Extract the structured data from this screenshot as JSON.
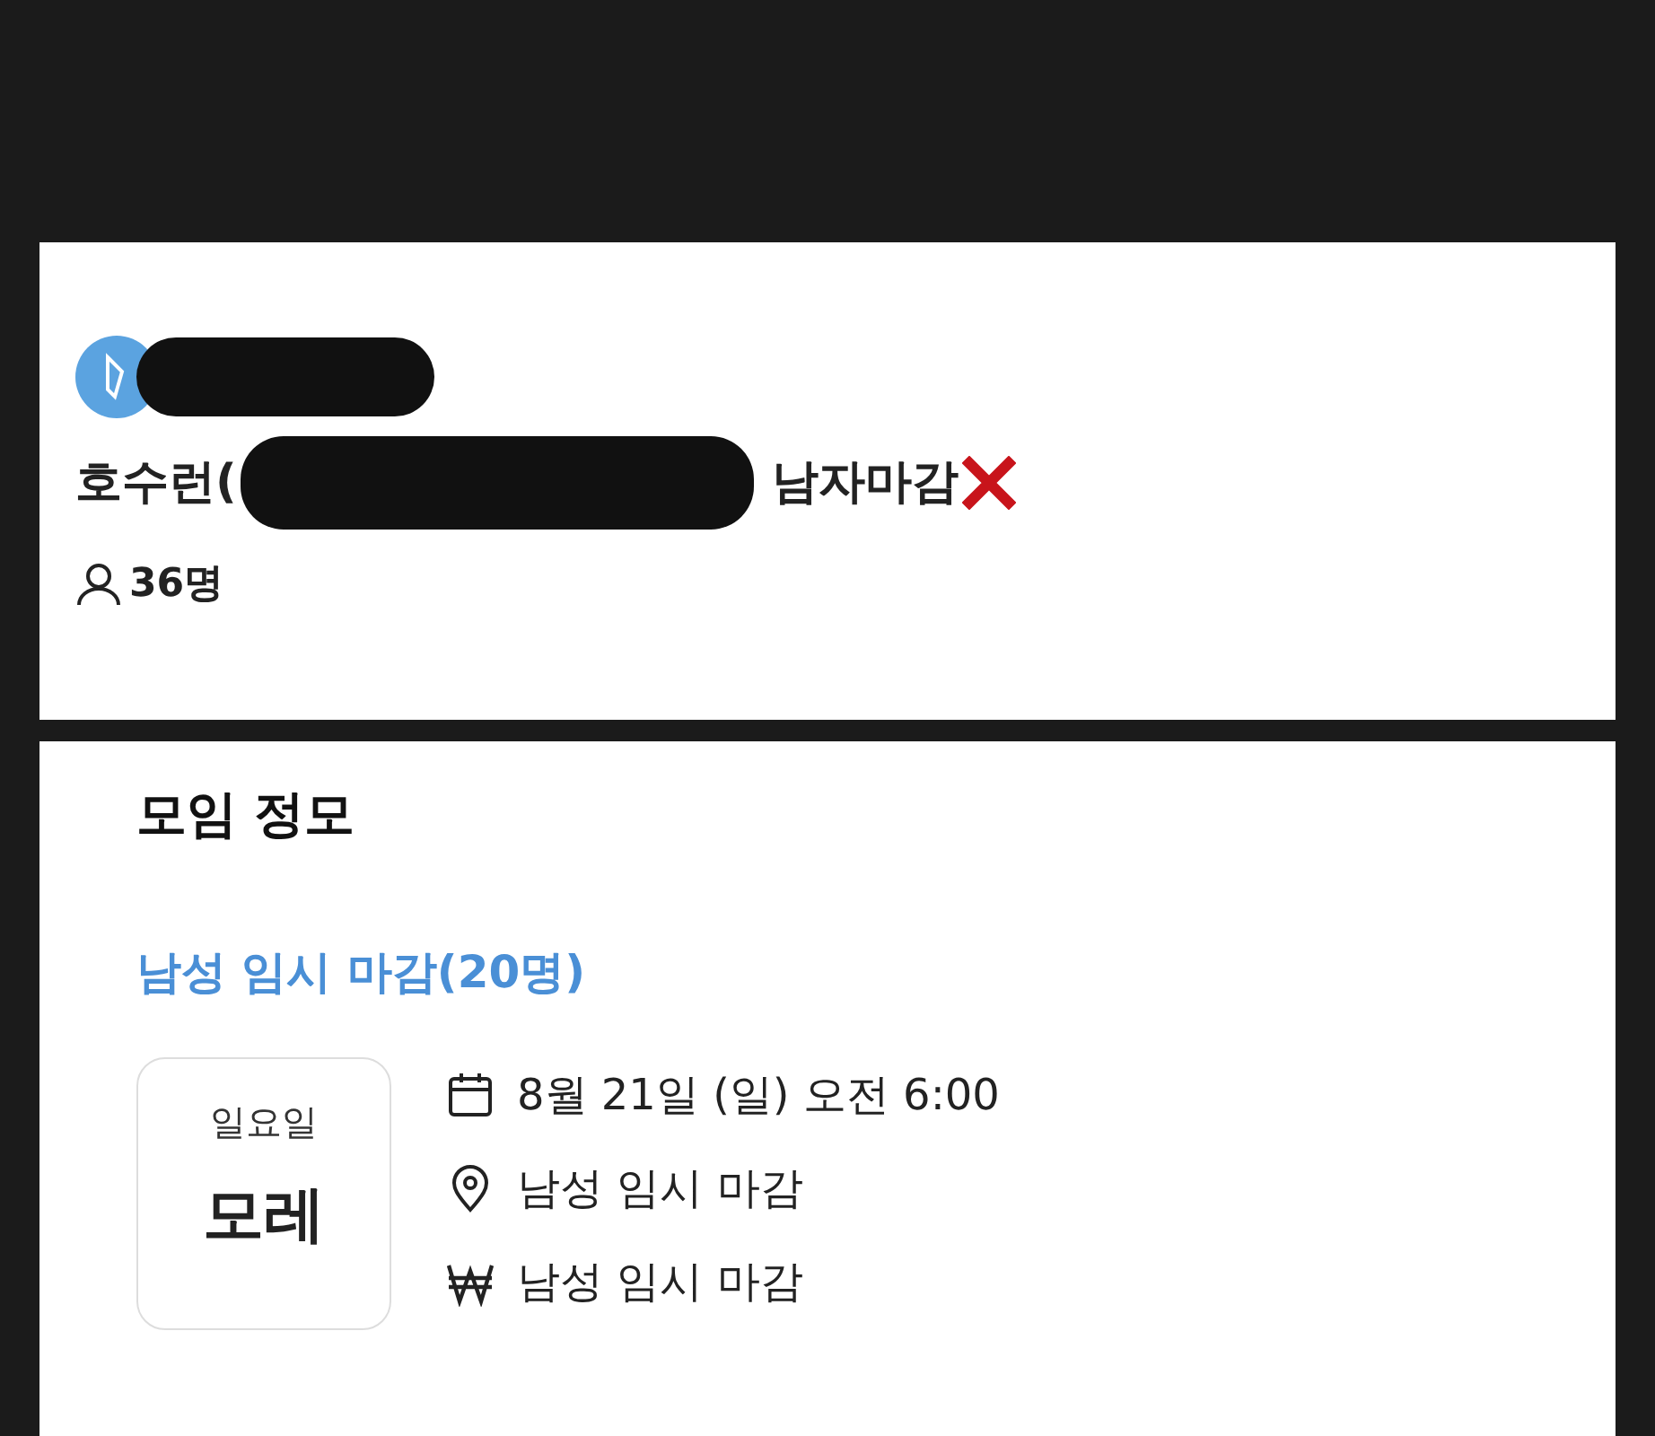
{
  "group": {
    "title_start": "호수런(",
    "title_end": "남자마감",
    "members": "36명"
  },
  "section": {
    "title": "모임 정모",
    "meetup": {
      "name": "남성 임시 마감(20명)",
      "weekday": "일요일",
      "day_label": "모레",
      "details": [
        {
          "kind": "date",
          "text": "8월 21일 (일) 오전 6:00"
        },
        {
          "kind": "place",
          "text": "남성 임시 마감"
        },
        {
          "kind": "fee",
          "text": "남성 임시 마감"
        }
      ]
    }
  }
}
